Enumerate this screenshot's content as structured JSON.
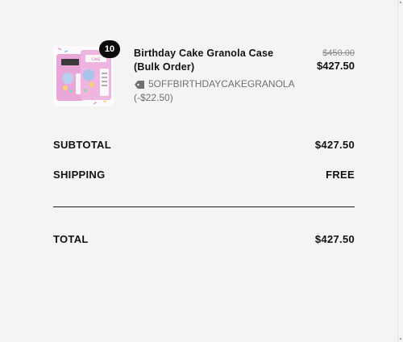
{
  "item": {
    "quantity": "10",
    "title": "Birthday Cake Granola Case (Bulk Order)",
    "discount_code": "5OFFBIRTHDAYCAKEGRANOLA",
    "discount_amount": "(-$22.50)",
    "original_price": "$450.00",
    "price": "$427.50",
    "image_icon": "granola-bag-product-image",
    "tag_icon": "discount-tag-icon"
  },
  "summary": {
    "subtotal_label": "SUBTOTAL",
    "subtotal_value": "$427.50",
    "shipping_label": "SHIPPING",
    "shipping_value": "FREE",
    "total_label": "TOTAL",
    "total_value": "$427.50"
  },
  "colors": {
    "background": "#f4f4f2",
    "text": "#111111",
    "muted": "#707070",
    "badge": "#0c0c0c",
    "product_pink": "#e9a6d6"
  }
}
